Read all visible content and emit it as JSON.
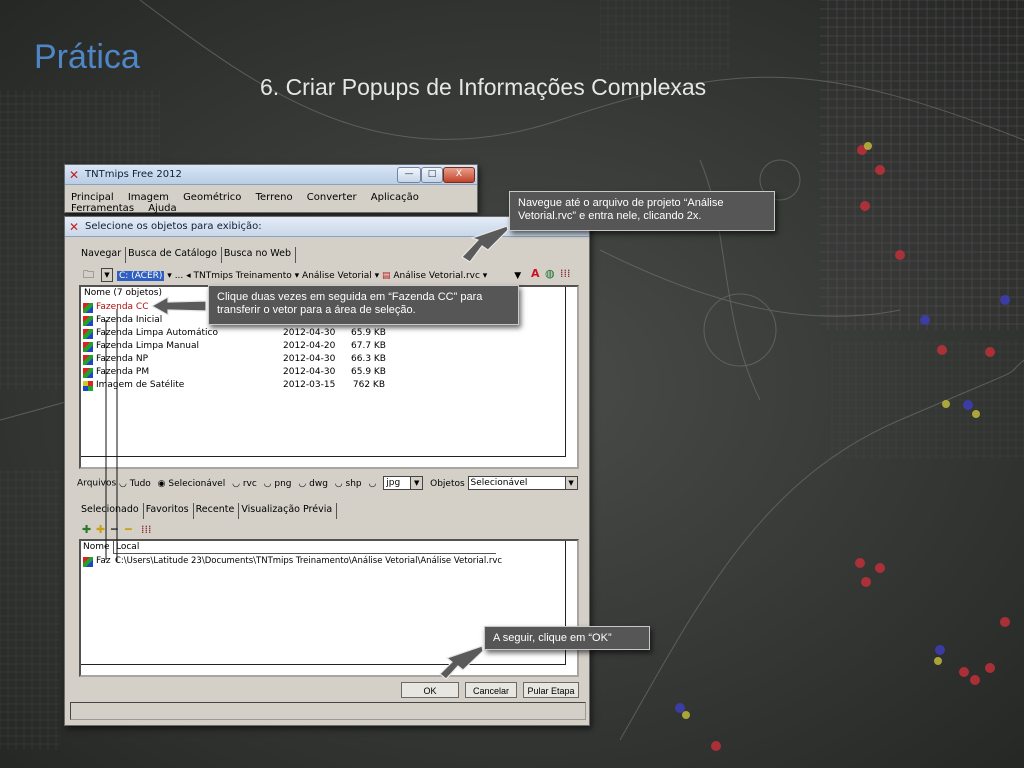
{
  "slide": {
    "title": "Prática",
    "subtitle": "6. Criar Popups de Informações Complexas"
  },
  "app_window": {
    "title": "TNTmips Free 2012",
    "controls": {
      "minimize": "—",
      "maximize": "□",
      "close": "X"
    },
    "menu": [
      "Principal",
      "Imagem",
      "Geométrico",
      "Terreno",
      "Converter",
      "Aplicação",
      "Ferramentas",
      "Ajuda"
    ]
  },
  "dialog": {
    "title": "Selecione os objetos para exibição:",
    "top_tabs": [
      "Navegar",
      "Busca de Catálogo",
      "Busca no Web"
    ],
    "path": {
      "drive": "C: (ACER)",
      "ellipsis": "...",
      "folder": "TNTmips Treinamento",
      "subfolder": "Análise Vetorial",
      "project": "Análise Vetorial.rvc"
    },
    "file_list_header": "Nome  (7 objetos)",
    "files": [
      {
        "name": "Fazenda CC",
        "date": "",
        "size": "",
        "icon": "vector-icon"
      },
      {
        "name": "Fazenda Inicial",
        "date": "",
        "size": "",
        "icon": "vector-icon"
      },
      {
        "name": "Fazenda Limpa Automático",
        "date": "2012-04-30",
        "size": "65.9 KB",
        "icon": "vector-icon"
      },
      {
        "name": "Fazenda Limpa Manual",
        "date": "2012-04-20",
        "size": "67.7 KB",
        "icon": "vector-icon"
      },
      {
        "name": "Fazenda NP",
        "date": "2012-04-30",
        "size": "66.3 KB",
        "icon": "vector-icon"
      },
      {
        "name": "Fazenda PM",
        "date": "2012-04-30",
        "size": "65.9 KB",
        "icon": "vector-icon"
      },
      {
        "name": "Imagem de Satélite",
        "date": "2012-03-15",
        "size": "762 KB",
        "icon": "raster-icon"
      }
    ],
    "filter": {
      "label": "Arquivos",
      "options": [
        "Tudo",
        "Selecionável",
        "rvc",
        "png",
        "dwg",
        "shp"
      ],
      "selected_option": "Selecionável",
      "ext_value": "jpg",
      "objects_label": "Objetos",
      "objects_value": "Selecionável"
    },
    "bottom_tabs": [
      "Selecionado",
      "Favoritos",
      "Recente",
      "Visualização Prévia"
    ],
    "selected_headers": {
      "name": "Nome",
      "location": "Local"
    },
    "selected_rows": [
      {
        "name": "Faz",
        "location": "C:\\Users\\Latitude 23\\Documents\\TNTmips Treinamento\\Análise Vetorial\\Análise Vetorial.rvc"
      }
    ],
    "buttons": {
      "ok": "OK",
      "cancel": "Cancelar",
      "skip": "Pular Etapa"
    }
  },
  "callouts": {
    "navigate": "Navegue até o arquivo de projeto “Análise Vetorial.rvc” e entra nele, clicando 2x.",
    "double_click": "Clique duas vezes em seguida em “Fazenda CC” para transferir  o vetor para a área de seleção.",
    "ok": "A seguir, clique em “OK”"
  },
  "colors": {
    "slide_title": "#4f86c6",
    "callout_bg": "#565656",
    "selection": "#2f5fc1",
    "dialog_face": "#d4d0c8"
  }
}
